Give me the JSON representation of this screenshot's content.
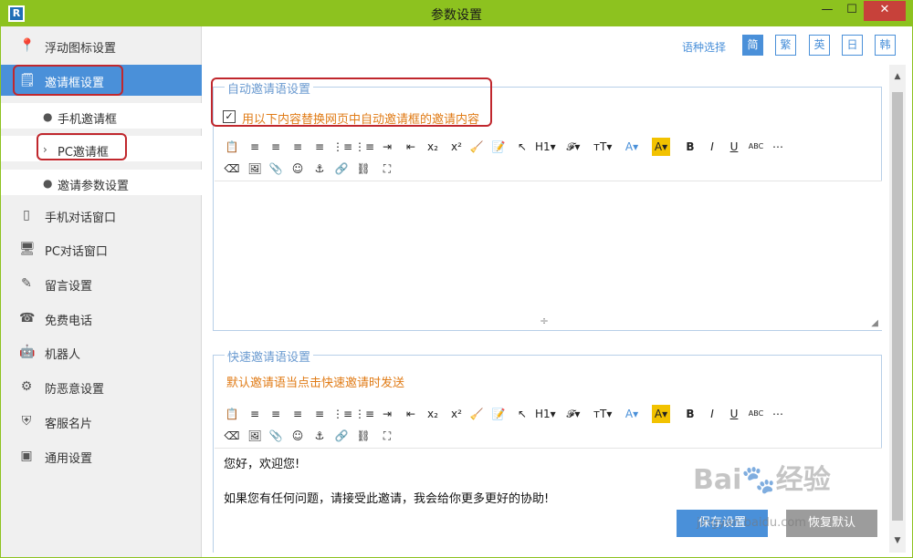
{
  "window": {
    "title": "参数设置",
    "logo": "R",
    "minimize_glyph": "—",
    "maximize_glyph": "☐",
    "close_glyph": "✕",
    "accent_color": "#8dc21f",
    "close_color": "#c7413a"
  },
  "sidebar": {
    "items": [
      {
        "label": "浮动图标设置",
        "icon": "pin-icon",
        "glyph": "📍"
      },
      {
        "label": "邀请框设置",
        "icon": "invite-card-icon",
        "glyph": "🗒",
        "active": true
      },
      {
        "label": "手机对话窗口",
        "icon": "phone-icon",
        "glyph": "▯"
      },
      {
        "label": "PC对话窗口",
        "icon": "monitor-icon",
        "glyph": "🖥"
      },
      {
        "label": "留言设置",
        "icon": "edit-note-icon",
        "glyph": "✎"
      },
      {
        "label": "免费电话",
        "icon": "telephone-icon",
        "glyph": "☎"
      },
      {
        "label": "机器人",
        "icon": "robot-icon",
        "glyph": "🤖"
      },
      {
        "label": "防恶意设置",
        "icon": "gear-icon",
        "glyph": "⚙"
      },
      {
        "label": "客服名片",
        "icon": "shield-icon",
        "glyph": "⛨"
      },
      {
        "label": "通用设置",
        "icon": "id-card-icon",
        "glyph": "▣"
      }
    ],
    "sub_items": [
      {
        "label": "手机邀请框",
        "bullet": "●"
      },
      {
        "label": "PC邀请框",
        "bullet": "›",
        "selected": true
      },
      {
        "label": "邀请参数设置",
        "bullet": "●"
      }
    ],
    "active_color": "#4a90d9"
  },
  "language": {
    "label": "语种选择",
    "options": [
      "简",
      "繁",
      "英",
      "日",
      "韩"
    ],
    "selected": "简"
  },
  "auto_invite": {
    "title": "自动邀请语设置",
    "checkbox_checked": true,
    "checkbox_glyph": "✓",
    "checkbox_label": "用以下内容替换网页中自动邀请框的邀请内容",
    "split_glyph": "÷",
    "grip_glyph": "◢"
  },
  "quick_invite": {
    "title": "快速邀请语设置",
    "hint": "默认邀请语当点击快速邀请时发送",
    "lines": [
      "您好，欢迎您!",
      "如果您有任何问题，请接受此邀请，我会给你更多更好的协助!"
    ]
  },
  "toolbar": {
    "row1": [
      "📋",
      "≡",
      "≡",
      "≡",
      "≡",
      "⋮≡",
      "⋮≡",
      "⇥",
      "⇤",
      "x₂",
      "x²",
      "🧹",
      "📝",
      "↖",
      "H1▾",
      "𝓕▾",
      "ᴛT▾",
      "A▾",
      "A▾",
      "B",
      "I",
      "U",
      "ABC",
      "⋯"
    ],
    "row1_names": [
      "paste-icon",
      "align-left-icon",
      "align-center-icon",
      "align-right-icon",
      "justify-icon",
      "ordered-list-icon",
      "unordered-list-icon",
      "indent-icon",
      "outdent-icon",
      "subscript-icon",
      "superscript-icon",
      "clear-format-icon",
      "format-painter-icon",
      "select-icon",
      "heading-icon",
      "font-family-icon",
      "font-size-icon",
      "font-color-icon",
      "highlight-icon",
      "bold-icon",
      "italic-icon",
      "underline-icon",
      "strikethrough-icon",
      "table-icon"
    ],
    "row2": [
      "⌫",
      "🖼",
      "📎",
      "☺",
      "⚓",
      "🔗",
      "⛓",
      "⛶"
    ],
    "row2_names": [
      "eraser-icon",
      "image-icon",
      "attachment-icon",
      "emoji-icon",
      "anchor-icon",
      "link-icon",
      "unlink-icon",
      "fullscreen-icon"
    ]
  },
  "buttons": {
    "save": "保存设置",
    "reset": "恢复默认"
  },
  "watermark": {
    "main": "Bai🐾经验",
    "sub": "jingyan.baidu.com"
  },
  "scroll": {
    "up_glyph": "▲",
    "down_glyph": "▼"
  }
}
